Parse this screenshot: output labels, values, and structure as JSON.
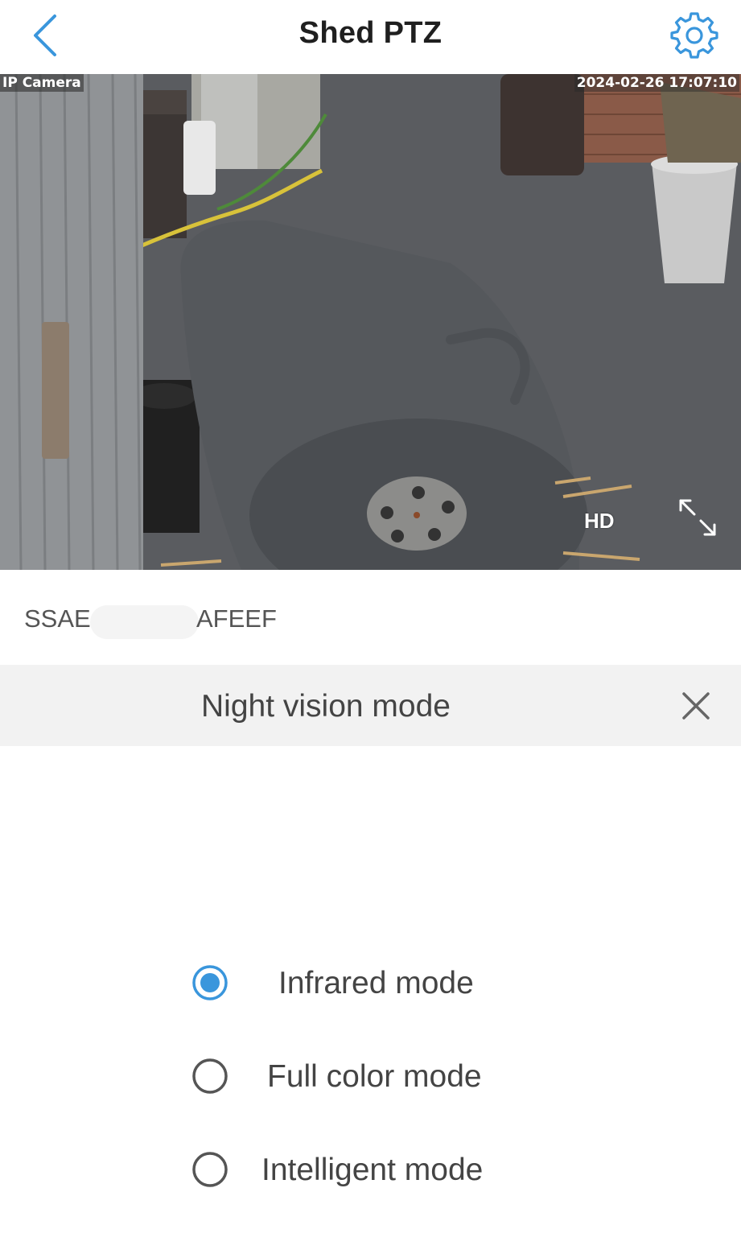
{
  "header": {
    "title": "Shed PTZ",
    "back_icon": "chevron-left-icon",
    "settings_icon": "gear-icon"
  },
  "video": {
    "osd_label": "IP Camera",
    "timestamp": "2024-02-26 17:07:10",
    "quality_label": "HD",
    "fullscreen_icon": "expand-icon"
  },
  "device": {
    "id_prefix": "SSAE",
    "id_suffix": "AFEEF"
  },
  "night_vision": {
    "title": "Night vision mode",
    "close_icon": "close-icon",
    "options": [
      {
        "label": "Infrared mode",
        "selected": true
      },
      {
        "label": "Full color mode",
        "selected": false
      },
      {
        "label": "Intelligent mode",
        "selected": false
      }
    ]
  },
  "colors": {
    "accent": "#3a96dc",
    "panel_bg": "#f2f2f2",
    "text": "#444444"
  }
}
